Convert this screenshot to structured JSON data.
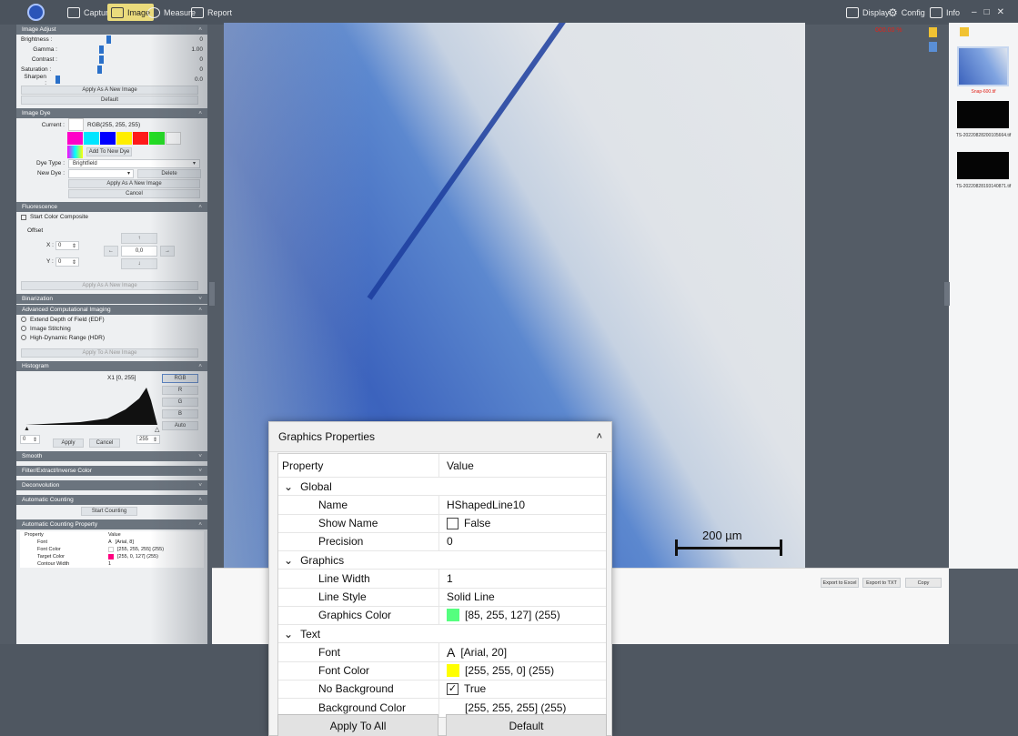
{
  "toolbar": {
    "capture": "Capture",
    "image": "Image",
    "measure": "Measure",
    "report": "Report",
    "display": "Display",
    "config": "Config",
    "info": "Info",
    "status_red": "000.00 %"
  },
  "left": {
    "image_adjust": {
      "title": "Image Adjust",
      "brightness_label": "Brightness :",
      "brightness_value": "0",
      "gamma_label": "Gamma :",
      "gamma_value": "1.00",
      "contrast_label": "Contrast :",
      "contrast_value": "0",
      "saturation_label": "Saturation :",
      "saturation_value": "0",
      "sharpen_label": "Sharpen :",
      "sharpen_value": "0.0",
      "apply_new": "Apply As A New Image",
      "default": "Default"
    },
    "image_dye": {
      "title": "Image Dye",
      "current_label": "Current :",
      "current_value": "RGB(255, 255, 255)",
      "add_new_dye": "Add To New Dye",
      "dye_type_label": "Dye Type :",
      "dye_type_value": "Brightfield",
      "new_dye_label": "New Dye :",
      "delete": "Delete",
      "apply_new": "Apply As A New Image",
      "cancel": "Cancel",
      "swatch_colors": [
        "#ff00c8",
        "#00e5ff",
        "#0000ff",
        "#ffee00",
        "#ff1a1a",
        "#22dd22",
        "#ffffff"
      ]
    },
    "fluorescence": {
      "title": "Fluorescence",
      "start_color_composite": "Start Color Composite",
      "offset": "Offset",
      "x_label": "X :",
      "x_value": "0",
      "y_label": "Y :",
      "y_value": "0",
      "center_value": "0,0",
      "apply_new": "Apply As A New Image"
    },
    "binarization": "Binarization",
    "aci": {
      "title": "Advanced Computational Imaging",
      "edf": "Extend Depth of Field (EDF)",
      "stitching": "Image Stitching",
      "hdr": "High-Dynamic Range (HDR)",
      "apply_new": "Apply To A New Image"
    },
    "histogram": {
      "title": "Histogram",
      "range": "X1 [0, 255]",
      "rgb": "RGB",
      "r": "R",
      "g": "G",
      "b": "B",
      "auto": "Auto",
      "min_value": "0",
      "max_value": "255",
      "apply": "Apply",
      "cancel": "Cancel"
    },
    "smooth": "Smooth",
    "filter": "Filter/Extract/Inverse Color",
    "deconvolution": "Deconvolution",
    "auto_counting": "Automatic Counting",
    "start_counting": "Start Counting",
    "acp": {
      "title": "Automatic Counting Property",
      "property": "Property",
      "value": "Value",
      "font_label": "Font",
      "font_value": "[Arial, 8]",
      "font_color_label": "Font Color",
      "font_color_value": "[255, 255, 255] (255)",
      "target_color_label": "Target Color",
      "target_color_value": "[255, 0, 127] (255)",
      "contour_width_label": "Contour Width",
      "contour_width_value": "1"
    }
  },
  "image": {
    "scale_label": "200 µm"
  },
  "thumbnails": [
    {
      "label": "Snap-600.tif",
      "color": "#e2231a"
    },
    {
      "label": "TS-20220828200105664.tif",
      "color": "#333333"
    },
    {
      "label": "TS-20220828193140871.tif",
      "color": "#333333"
    }
  ],
  "bottom": {
    "export_excel": "Export to Excel",
    "export_txt": "Export to TXT",
    "copy": "Copy"
  },
  "graphics_properties": {
    "title": "Graphics Properties",
    "col_property": "Property",
    "col_value": "Value",
    "global": "Global",
    "name_label": "Name",
    "name_value": "HShapedLine10",
    "show_name_label": "Show Name",
    "show_name_value": "False",
    "precision_label": "Precision",
    "precision_value": "0",
    "graphics": "Graphics",
    "line_width_label": "Line Width",
    "line_width_value": "1",
    "line_style_label": "Line Style",
    "line_style_value": "Solid Line",
    "graphics_color_label": "Graphics Color",
    "graphics_color_value": "[85, 255, 127] (255)",
    "graphics_color_swatch": "#55ff7f",
    "text": "Text",
    "font_label": "Font",
    "font_value": "[Arial, 20]",
    "font_color_label": "Font Color",
    "font_color_value": "[255, 255, 0] (255)",
    "font_color_swatch": "#ffff00",
    "no_background_label": "No Background",
    "no_background_value": "True",
    "background_color_label": "Background Color",
    "background_color_value": "[255, 255, 255] (255)",
    "background_color_swatch": "#ffffff",
    "apply_to_all": "Apply To All",
    "default": "Default"
  }
}
